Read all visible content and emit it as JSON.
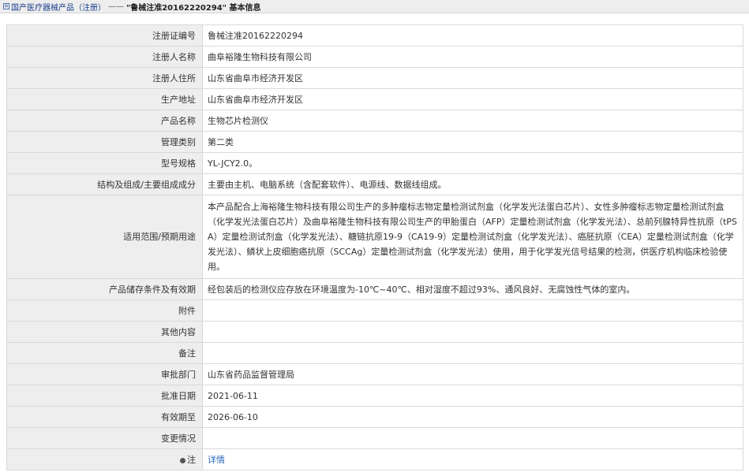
{
  "breadcrumb": {
    "root": "国产医疗器械产品（注册）",
    "separator": "——",
    "current": "\"鲁械注准20162220294\" 基本信息"
  },
  "rows": [
    {
      "label": "注册证编号",
      "value": "鲁械注准20162220294"
    },
    {
      "label": "注册人名称",
      "value": "曲阜裕隆生物科技有限公司"
    },
    {
      "label": "注册人住所",
      "value": "山东省曲阜市经济开发区"
    },
    {
      "label": "生产地址",
      "value": "山东省曲阜市经济开发区"
    },
    {
      "label": "产品名称",
      "value": "生物芯片检测仪"
    },
    {
      "label": "管理类别",
      "value": "第二类"
    },
    {
      "label": "型号规格",
      "value": "YL-JCY2.0。"
    },
    {
      "label": "结构及组成/主要组成成分",
      "value": "主要由主机、电脑系统（含配套软件）、电源线、数据线组成。"
    },
    {
      "label": "适用范围/预期用途",
      "value": "本产品配合上海裕隆生物科技有限公司生产的多肿瘤标志物定量检测试剂盒（化学发光法蛋白芯片）、女性多肿瘤标志物定量检测试剂盒（化学发光法蛋白芯片）及曲阜裕隆生物科技有限公司生产的甲胎蛋白（AFP）定量检测试剂盒（化学发光法）、总前列腺特异性抗原（tPSA）定量检测试剂盒（化学发光法）、糖链抗原19-9（CA19-9）定量检测试剂盒（化学发光法）、癌胚抗原（CEA）定量检测试剂盒（化学发光法）、鳞状上皮细胞癌抗原（SCCAg）定量检测试剂盒（化学发光法）使用，用于化学发光信号结果的检测，供医疗机构临床检验使用。"
    },
    {
      "label": "产品储存条件及有效期",
      "value": "经包装后的检测仪应存放在环境温度为-10℃~40℃、相对湿度不超过93%、通风良好、无腐蚀性气体的室内。"
    },
    {
      "label": "附件",
      "value": ""
    },
    {
      "label": "其他内容",
      "value": ""
    },
    {
      "label": "备注",
      "value": ""
    },
    {
      "label": "审批部门",
      "value": "山东省药品监督管理局"
    },
    {
      "label": "批准日期",
      "value": "2021-06-11"
    },
    {
      "label": "有效期至",
      "value": "2026-06-10"
    },
    {
      "label": "变更情况",
      "value": ""
    },
    {
      "label": "注",
      "value": "详情"
    }
  ]
}
